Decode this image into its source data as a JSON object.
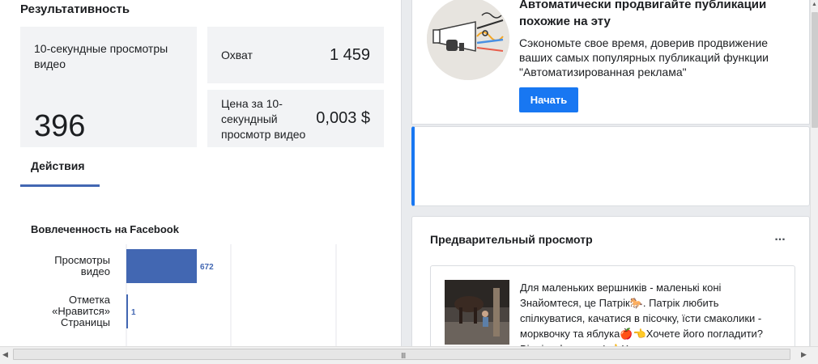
{
  "performance": {
    "title": "Результативность",
    "video_views_label": "10-секундные просмотры видео",
    "video_views_value": "396",
    "reach_label": "Охват",
    "reach_value": "1 459",
    "cost_label": "Цена за 10-секундный просмотр видео",
    "cost_value": "0,003 $"
  },
  "tabs": {
    "actions": "Действия"
  },
  "chart_data": {
    "type": "bar",
    "orientation": "horizontal",
    "title": "Вовлеченность на Facebook",
    "categories": [
      [
        "Просмотры",
        "видео"
      ],
      [
        "Отметка",
        "«Нравится»",
        "Страницы"
      ]
    ],
    "values": [
      672,
      1
    ],
    "data_labels": [
      "672",
      "1"
    ],
    "xlim": [
      0,
      1000
    ],
    "grid": true,
    "bar_color": "#4267b2"
  },
  "promo": {
    "title": "Автоматически продвигайте публикации похожие на эту",
    "text": "Сэкономьте свое время, доверив продвижение ваших самых популярных публикаций функции \"Автоматизированная реклама\"",
    "button": "Начать",
    "accent": "#1877f2"
  },
  "preview": {
    "title": "Предварительный просмотр",
    "more": "...",
    "post_text": "Для маленьких вершників - маленькі коні Знайомтеся, це Патрік🐎. Патрік любить спілкуватися, качатися в пісочку, їсти смаколики - морквочку та яблука🍎👈Хочете його погладити? Візміть фруктики! 👈Хочете покататися -"
  },
  "scrollbar": {
    "grip": "III"
  },
  "icons": {
    "more": "more-icon",
    "scroll_up": "scroll-up-arrow-icon",
    "scroll_left": "scroll-left-arrow-icon",
    "scroll_right": "scroll-right-arrow-icon"
  }
}
